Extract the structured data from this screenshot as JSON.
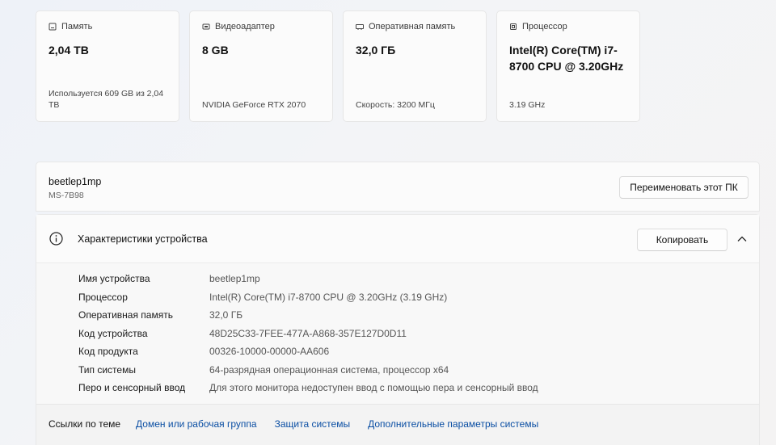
{
  "cards": [
    {
      "title": "Память",
      "icon": "storage-icon",
      "value": "2,04 TB",
      "note": "Используется 609 GB из 2,04 TB"
    },
    {
      "title": "Видеоадаптер",
      "icon": "gpu-icon",
      "value": "8 GB",
      "note": "NVIDIA GeForce RTX 2070"
    },
    {
      "title": "Оперативная память",
      "icon": "ram-icon",
      "value": "32,0 ГБ",
      "note": "Скорость: 3200 МГц"
    },
    {
      "title": "Процессор",
      "icon": "cpu-icon",
      "value": "Intel(R) Core(TM) i7-8700 CPU @ 3.20GHz",
      "note": "3.19 GHz"
    }
  ],
  "pc": {
    "name": "beetlep1mp",
    "model": "MS-7B98",
    "rename_label": "Переименовать этот ПК"
  },
  "specs": {
    "title": "Характеристики устройства",
    "copy_label": "Копировать",
    "rows": [
      {
        "label": "Имя устройства",
        "value": "beetlep1mp"
      },
      {
        "label": "Процессор",
        "value": "Intel(R) Core(TM) i7-8700 CPU @ 3.20GHz (3.19 GHz)"
      },
      {
        "label": "Оперативная память",
        "value": "32,0 ГБ"
      },
      {
        "label": "Код устройства",
        "value": "48D25C33-7FEE-477A-A868-357E127D0D11"
      },
      {
        "label": "Код продукта",
        "value": "00326-10000-00000-AA606"
      },
      {
        "label": "Тип системы",
        "value": "64-разрядная операционная система, процессор x64"
      },
      {
        "label": "Перо и сенсорный ввод",
        "value": "Для этого монитора недоступен ввод с помощью пера и сенсорный ввод"
      }
    ]
  },
  "related_links": {
    "title": "Ссылки по теме",
    "links": [
      "Домен или рабочая группа",
      "Защита системы",
      "Дополнительные параметры системы"
    ]
  },
  "colors": {
    "link": "#0a4ea3",
    "accent": "#0a4ea3"
  }
}
